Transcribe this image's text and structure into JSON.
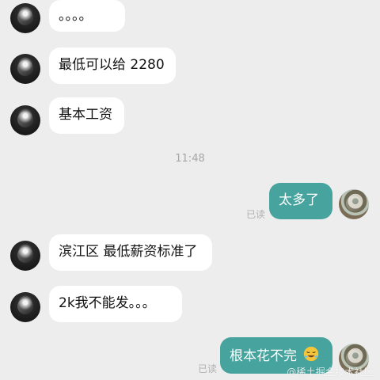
{
  "messages": [
    {
      "side": "other",
      "text": "。。。。"
    },
    {
      "side": "other",
      "text": "最低可以给 2280"
    },
    {
      "side": "other",
      "text": "基本工资"
    },
    {
      "type": "time",
      "text": "11:48"
    },
    {
      "side": "me",
      "text": "太多了",
      "status": "已读"
    },
    {
      "side": "other",
      "text": "滨江区 最低薪资标准了"
    },
    {
      "side": "other",
      "text": "2k我不能发。。。"
    },
    {
      "side": "me",
      "text": "根本花不完",
      "status": "已读",
      "emoji": "crying-laughing-emoji"
    }
  ],
  "watermark": "@稀土掘金技术社区"
}
